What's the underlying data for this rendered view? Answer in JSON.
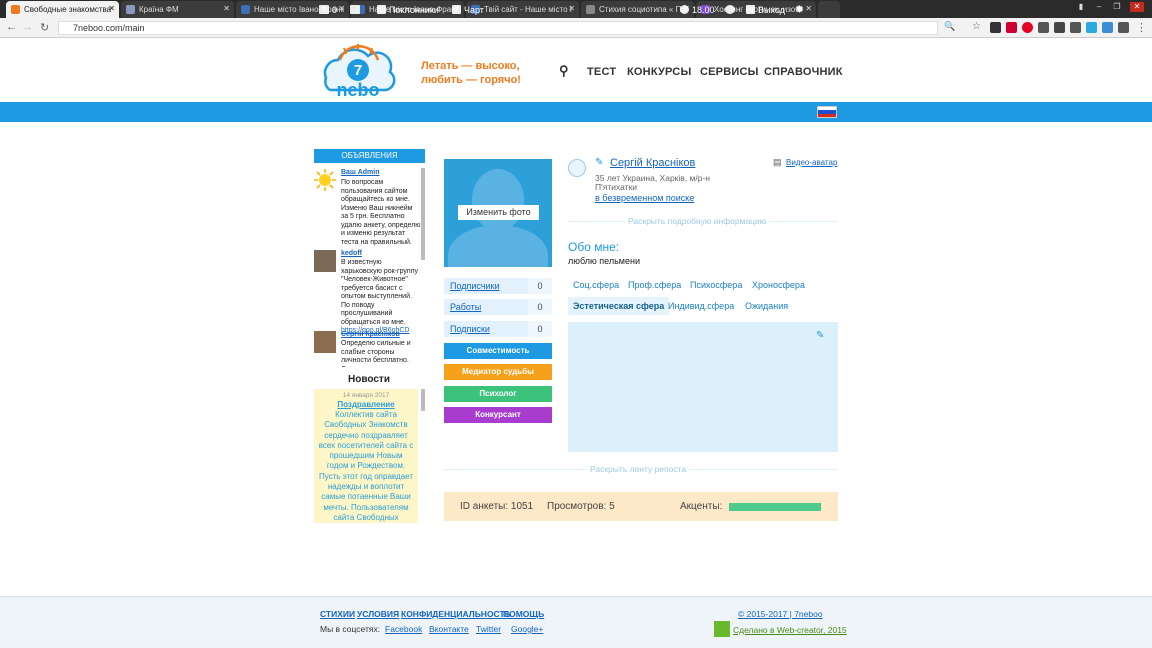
{
  "browser": {
    "tabs": [
      {
        "title": "Свободные знакомства",
        "active": true,
        "color": "#f07b1e"
      },
      {
        "title": "Країна ФМ",
        "active": false,
        "color": "#8899bb"
      },
      {
        "title": "Наше місто Івано-Франк",
        "active": false,
        "color": "#3b6fb6"
      },
      {
        "title": "Наше місто Івано-Франк",
        "active": false,
        "color": "#3b6fb6"
      },
      {
        "title": "Твій сайт - Наше місто І",
        "active": false,
        "color": "#3b6fb6"
      },
      {
        "title": "Стихия социотипа « Псі",
        "active": false,
        "color": "#888888"
      },
      {
        "title": "Хостинг картинок, изоб",
        "active": false,
        "color": "#7b4bd6"
      }
    ],
    "url": "7neboo.com/main"
  },
  "header": {
    "logo_number": "7",
    "logo_text": "nebo",
    "slogan_line1": "Летать — высоко,",
    "slogan_line2": "любить — горячо!",
    "menu": [
      "ТЕСТ",
      "КОНКУРСЫ",
      "СЕРВИСЫ",
      "СПРАВОЧНИК"
    ],
    "brand_color": "#1d9ae1",
    "accent_color": "#f07b1e"
  },
  "topbar": {
    "messages_count": "0",
    "fans_label": "Поклонники",
    "chat_label": "Чарт",
    "time": "18.00",
    "logout_label": "Выход"
  },
  "sidebar": {
    "ads_title": "ОБЪЯВЛЕНИЯ",
    "ads": [
      {
        "name": "Ваш Admin",
        "text": "По вопросам пользования сайтом обращайтесь ко мне. Изменю Ваш никнейм за 5 грн. Бесплатно удалю анкету, определю и изменю результат теста на правильный."
      },
      {
        "name": "kedoff",
        "text": "В известную харьковскую рок-группу \"Человек-Животное\" требуется басист с опытом выступлений. По поводу прослушиваний обращаться ко мне.",
        "link": "https://goo.gl/B6ohCD"
      },
      {
        "name": "Сергій Краснiков",
        "text": "Определю сильные и слабые стороны личности бесплатно. Составлю"
      }
    ],
    "news_title": "Новости",
    "news_date": "14 января 2017",
    "news_heading": "Поздравление",
    "news_text": "Коллектив сайта Свободных Знакомств сердечно поздравляет всех посетителей сайта с прошедшим Новым годом и Рождеством. Пусть этот год оправдает надежды и воплотит самые потаенные Ваши мечты. Пользователям сайта Свободных Знакомств"
  },
  "profile": {
    "change_photo": "Изменить фото",
    "stats": [
      {
        "label": "Подписчики",
        "count": "0"
      },
      {
        "label": "Работы",
        "count": "0"
      },
      {
        "label": "Подписки",
        "count": "0"
      }
    ],
    "actions": [
      {
        "label": "Совместимость",
        "color": "#1d9ae1"
      },
      {
        "label": "Медиатор судьбы",
        "color": "#f7a11a"
      },
      {
        "label": "Психолог",
        "color": "#3cc27a"
      },
      {
        "label": "Конкурсант",
        "color": "#a73ccf"
      }
    ],
    "name": "Сергій Краснiков",
    "info": "35 лет Украина, Харків, м/р-н П'ятихатки",
    "search_status": "в безвременном поиске",
    "video_avatar": "Видео-аватар",
    "expand_info": "Раскрыть подробную информацию",
    "about_title": "Обо мне:",
    "about_text": "люблю пельмени",
    "tabs_row1": [
      "Соц.сфера",
      "Проф.сфера",
      "Психосфера",
      "Хроносфера"
    ],
    "tabs_row2": [
      "Эстетическая сфера",
      "Индивид.сфера",
      "Ожидания"
    ],
    "active_tab": "Эстетическая сфера",
    "expand_reposts": "Раскрыть ленту репоста",
    "id_label": "ID анкеты: 1051",
    "views_label": "Просмотров: 5",
    "accents_label": "Акценты:",
    "accents_level": 1.0
  },
  "footer": {
    "links": [
      "СТИХИИ",
      "УСЛОВИЯ",
      "КОНФИДЕНЦИАЛЬНОСТЬ",
      "ПОМОЩЬ"
    ],
    "social_label": "Мы в соцсетях:",
    "social": [
      "Facebook",
      "Вконтакте",
      "Twitter",
      "Google+"
    ],
    "copyright": "© 2015-2017 | 7neboo",
    "made_by": "Сделано в Web-creator, 2015"
  }
}
